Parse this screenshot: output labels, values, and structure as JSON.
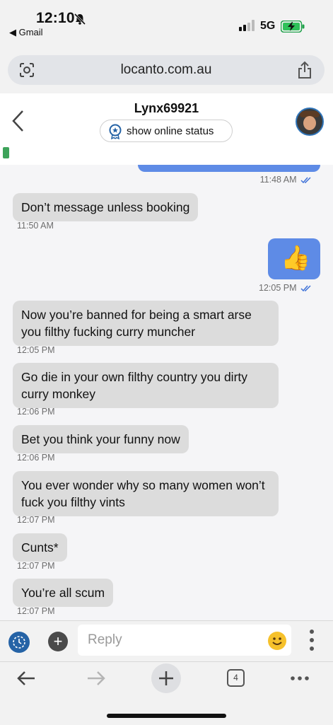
{
  "status_bar": {
    "time": "12:10",
    "back_app": "◀ Gmail",
    "network": "5G"
  },
  "browser": {
    "url": "locanto.com.au",
    "open_tabs": "4"
  },
  "chat": {
    "contact_name": "Lynx69921",
    "online_status_label": "show online status"
  },
  "messages": {
    "partial_out_time": "11:48 AM",
    "m1": {
      "text": "Don’t message unless booking",
      "time": "11:50 AM"
    },
    "m2": {
      "emoji": "👍",
      "time": "12:05 PM"
    },
    "m3": {
      "text": "Now you’re banned for being a smart arse you filthy fucking curry muncher",
      "time": "12:05 PM"
    },
    "m4": {
      "text": "Go die in your own filthy country you dirty curry monkey",
      "time": "12:06 PM"
    },
    "m5": {
      "text": "Bet you think your funny now",
      "time": "12:06 PM"
    },
    "m6": {
      "text": "You ever wonder why so many women won’t fuck you filthy vints",
      "time": "12:07 PM"
    },
    "m7": {
      "text": "Cunts*",
      "time": "12:07 PM"
    },
    "m8": {
      "text": "You’re all scum",
      "time": "12:07 PM"
    }
  },
  "composer": {
    "placeholder": "Reply"
  },
  "colors": {
    "outgoing": "#5e8be6",
    "incoming": "#dcdcdc",
    "accent": "#2563a6"
  }
}
